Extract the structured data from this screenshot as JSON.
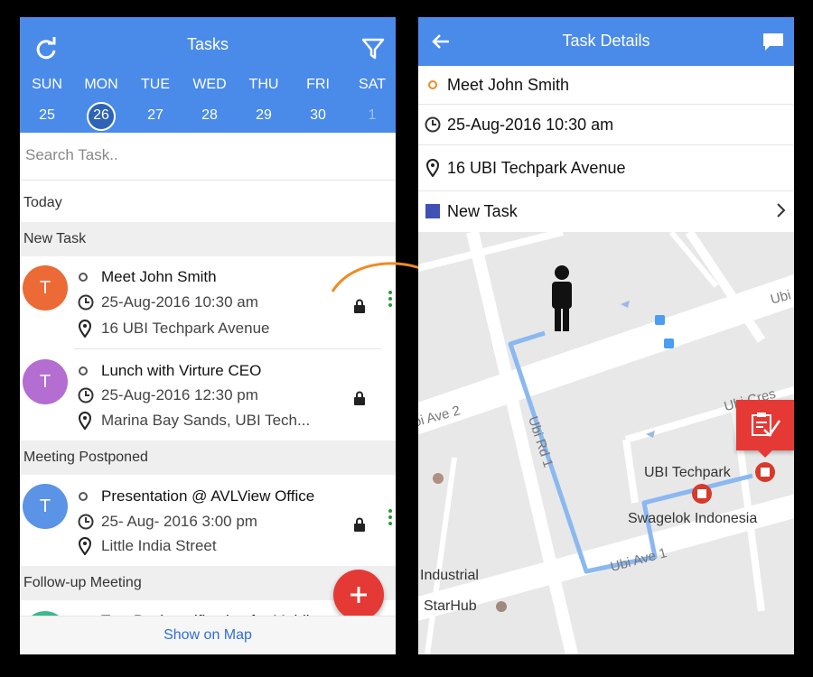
{
  "left": {
    "header": {
      "title": "Tasks",
      "refresh_icon": "refresh-icon",
      "filter_icon": "filter-icon"
    },
    "week": [
      {
        "name": "SUN",
        "date": "25"
      },
      {
        "name": "MON",
        "date": "26",
        "selected": true
      },
      {
        "name": "TUE",
        "date": "27"
      },
      {
        "name": "WED",
        "date": "28"
      },
      {
        "name": "THU",
        "date": "29"
      },
      {
        "name": "FRI",
        "date": "30"
      },
      {
        "name": "SAT",
        "date": "1",
        "dim": true
      }
    ],
    "search": {
      "placeholder": "Search Task.."
    },
    "sections": {
      "today": "Today",
      "new_task": "New Task",
      "meeting_postponed": "Meeting Postponed",
      "followup": "Follow-up Meeting"
    },
    "tasks": [
      {
        "initial": "T",
        "color": "#ec6a35",
        "title": "Meet John Smith",
        "datetime": "25-Aug-2016 10:30 am",
        "location": "16 UBI Techpark Avenue",
        "locked": true,
        "menu": true
      },
      {
        "initial": "T",
        "color": "#b46dd0",
        "title": "Lunch with Virture CEO",
        "datetime": "25-Aug-2016 12:30 pm",
        "location": "Marina Bay Sands, UBI Tech...",
        "locked": true,
        "menu": false
      },
      {
        "initial": "T",
        "color": "#5b93e6",
        "title": "Presentation @ AVLView Office",
        "datetime": "25- Aug- 2016 3:00 pm",
        "location": "Little India Street",
        "locked": true,
        "menu": true
      }
    ],
    "partial_task": {
      "title": "Test Push notification for Mobile",
      "color": "#3db88a"
    },
    "fab_label": "+",
    "bottom_link": "Show on Map"
  },
  "right": {
    "header": {
      "title": "Task Details",
      "back_icon": "back-arrow-icon",
      "chat_icon": "chat-icon"
    },
    "title": "Meet John Smith",
    "datetime": "25-Aug-2016 10:30 am",
    "location": "16 UBI Techpark Avenue",
    "status": "New Task",
    "status_color": "#3f51b5",
    "map": {
      "labels": {
        "ubi_techpark": "UBI Techpark",
        "swagelok": "Swagelok Indonesia",
        "industrial": "i Industrial",
        "starhub": "StarHub"
      },
      "roads": {
        "ubi_ave_2": "oi Ave 2",
        "ubi_rd_1": "Ubi Rd 1",
        "ubi_ave_1": "Ubi Ave 1",
        "ubi_top": "Ubi",
        "ubi_cres": "Ubi Cres"
      }
    }
  },
  "colors": {
    "header_blue": "#4a8bea",
    "accent_red": "#e53935",
    "route_blue": "#8bb8f0",
    "connector_orange": "#ef8b24"
  }
}
